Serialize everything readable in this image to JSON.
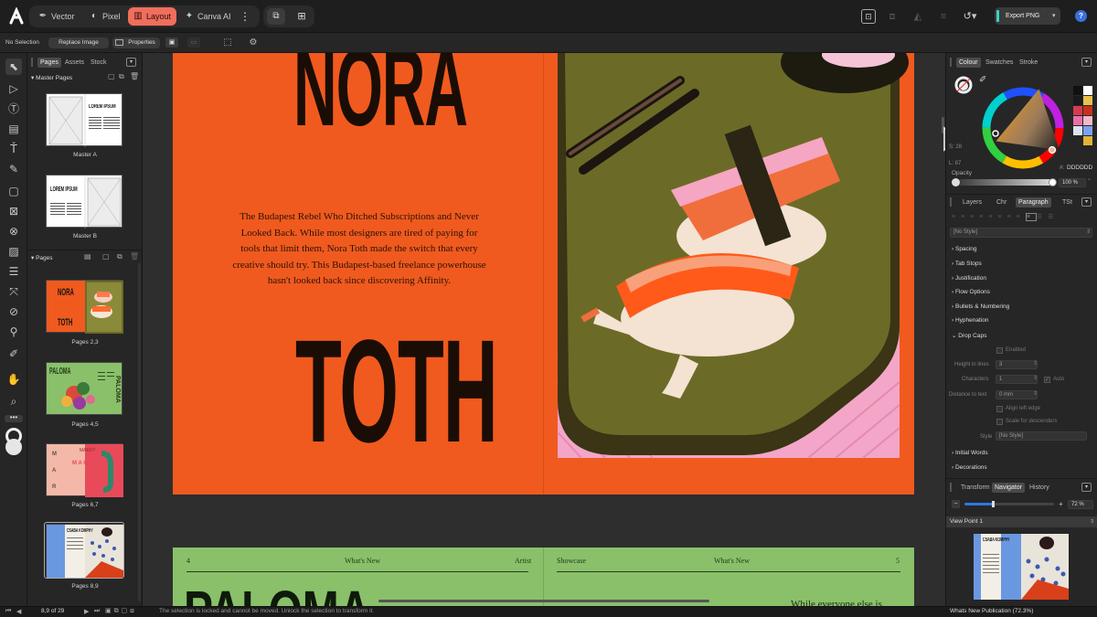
{
  "app": {
    "modes": [
      {
        "label": "Vector",
        "icon": "vector-icon"
      },
      {
        "label": "Pixel",
        "icon": "pixel-icon"
      },
      {
        "label": "Layout",
        "icon": "layout-icon"
      },
      {
        "label": "Canva AI",
        "icon": "sparkle-icon"
      }
    ],
    "active_mode": "Layout",
    "export_label": "Export PNG",
    "help": "?"
  },
  "context": {
    "selection": "No Selection",
    "replace_image": "Replace Image",
    "properties": "Properties"
  },
  "left_panel": {
    "tabs": [
      "Pages",
      "Assets",
      "Stock"
    ],
    "master_section": "Master Pages",
    "masters": [
      {
        "label": "Master A",
        "thumb_text": "LOREM IPSUM"
      },
      {
        "label": "Master B",
        "thumb_text": "LOREM IPSUM"
      }
    ],
    "pages_section": "Pages",
    "pages": [
      {
        "label": "Pages 2,3",
        "thumb_text": "NORA TOTH"
      },
      {
        "label": "Pages 4,5",
        "thumb_text": "PALOMA"
      },
      {
        "label": "Pages 6,7",
        "thumb_text": "MAKKY"
      },
      {
        "label": "Pages 8,9",
        "thumb_text": "CSABA KOMPHY"
      }
    ]
  },
  "spread": {
    "title_top": "NORA",
    "title_bottom": "TOTH",
    "body": "The Budapest Rebel Who Ditched Subscriptions and Never Looked Back. While most designers are tired of paying for tools that limit them, Nora Toth made the switch that every creative should try. This Budapest-based freelance powerhouse hasn't looked back since discovering Affinity.",
    "next_left_num": "4",
    "next_left_center": "What's New",
    "next_left_right": "Artist",
    "next_right_left": "Showcase",
    "next_right_center": "What's New",
    "next_right_num": "5",
    "next_title": "PALOMA",
    "next_body": "While everyone else is"
  },
  "right_panel": {
    "colour_tabs": [
      "Colour",
      "Swatches",
      "Stroke"
    ],
    "hsl": {
      "s": "S: 28",
      "l": "L: 87"
    },
    "hex_label": "#:",
    "hex_value": "DDDDDD",
    "opacity_label": "Opacity",
    "opacity_value": "100 %",
    "para_tabs": [
      "Layers",
      "Chr",
      "Paragraph",
      "TSt"
    ],
    "style_dropdown": "[No Style]",
    "sections": [
      "Spacing",
      "Tab Stops",
      "Justification",
      "Flow Options",
      "Bullets & Numbering",
      "Hyphenation",
      "Drop Caps"
    ],
    "drop_caps": {
      "enabled": "Enabled",
      "height_label": "Height in lines",
      "height_value": "3",
      "chars_label": "Characters",
      "chars_value": "1",
      "auto": "Auto",
      "distance_label": "Distance to text",
      "distance_value": "0 mm",
      "align_left": "Align left edge",
      "scale_desc": "Scale for descenders",
      "style_label": "Style",
      "style_value": "[No Style]"
    },
    "sections_after": [
      "Initial Words",
      "Decorations"
    ],
    "nav_tabs": [
      "Transform",
      "Navigator",
      "History"
    ],
    "zoom_value": "72 %",
    "viewpoint": "View Point 1",
    "nav_thumb_text": "CSABA KOMPHY",
    "doc_status": "Whats New Publication (72.3%)"
  },
  "status": {
    "page_count": "8,9 of 29",
    "message": "The selection is locked and cannot be moved. Unlock the selection to transform it."
  },
  "colors": {
    "accent": "#f06e5c",
    "spread_orange": "#f05a1e",
    "spread_olive": "#6b6b27",
    "spread_green": "#8ac06a"
  }
}
